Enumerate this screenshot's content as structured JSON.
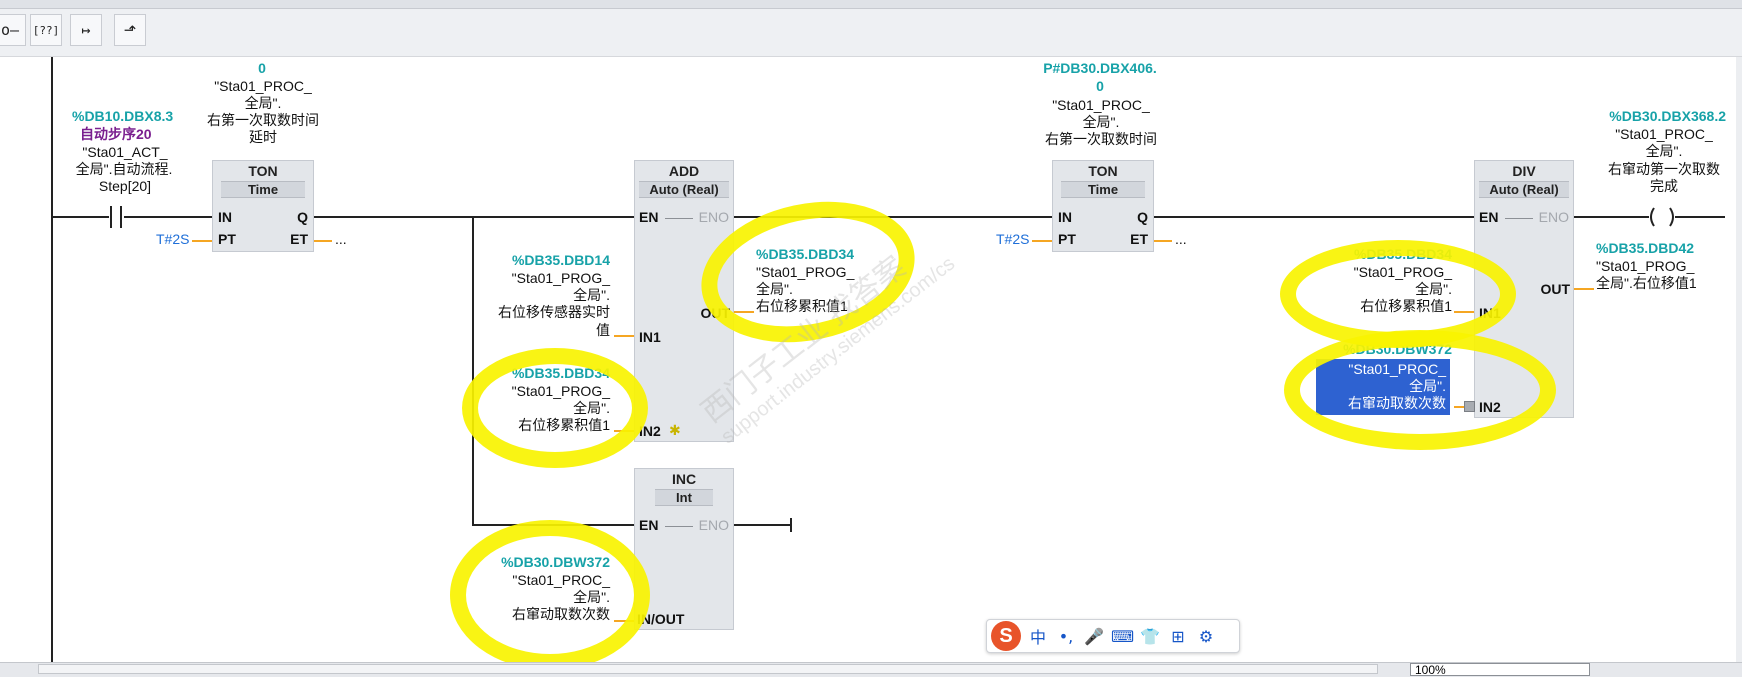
{
  "toolbar": {
    "buttons": [
      {
        "name": "open-branch-icon",
        "glyph": "o—"
      },
      {
        "name": "empty-box-icon",
        "glyph": "[??]"
      },
      {
        "name": "branch-open-icon",
        "glyph": "↦"
      },
      {
        "name": "branch-close-icon",
        "glyph": "⬏"
      }
    ]
  },
  "network": {
    "contact1": {
      "address": "%DB10.DBX8.3",
      "comment": "自动步序20",
      "l1": "\"Sta01_ACT_",
      "l2": "全局\".自动流程.",
      "l3": "Step[20]"
    },
    "ton1": {
      "top_value": "0",
      "l1": "\"Sta01_PROC_",
      "l2": "全局\".",
      "l3": "右第一次取数时间",
      "l4": "延时",
      "title": "TON",
      "type": "Time",
      "pt": "T#2S",
      "et": "...",
      "pins": {
        "in": "IN",
        "q": "Q",
        "pt": "PT",
        "et": "ET"
      }
    },
    "add": {
      "title": "ADD",
      "type": "Auto (Real)",
      "en": "EN",
      "eno": "ENO",
      "out": "OUT",
      "in1": "IN1",
      "in2": "IN2",
      "in1_addr": "%DB35.DBD14",
      "in1_l1": "\"Sta01_PROG_",
      "in1_l2": "全局\".",
      "in1_l3": "右位移传感器实时",
      "in1_l4": "值",
      "in2_addr": "%DB35.DBD34",
      "in2_l1": "\"Sta01_PROG_",
      "in2_l2": "全局\".",
      "in2_l3": "右位移累积值1",
      "out_addr": "%DB35.DBD34",
      "out_l1": "\"Sta01_PROG_",
      "out_l2": "全局\".",
      "out_l3": "右位移累积值1"
    },
    "inc": {
      "title": "INC",
      "type": "Int",
      "en": "EN",
      "eno": "ENO",
      "inout": "IN/OUT",
      "addr": "%DB30.DBW372",
      "l1": "\"Sta01_PROC_",
      "l2": "全局\".",
      "l3": "右窜动取数次数"
    },
    "ton2": {
      "top_addr": "P#DB30.DBX406.",
      "top_value": "0",
      "l1": "\"Sta01_PROC_",
      "l2": "全局\".",
      "l3": "右第一次取数时间",
      "title": "TON",
      "type": "Time",
      "pt": "T#2S",
      "et": "...",
      "pins": {
        "in": "IN",
        "q": "Q",
        "pt": "PT",
        "et": "ET"
      }
    },
    "div": {
      "title": "DIV",
      "type": "Auto (Real)",
      "en": "EN",
      "eno": "ENO",
      "out": "OUT",
      "in1": "IN1",
      "in2": "IN2",
      "in1_addr": "%DB35.DBD34",
      "in1_l1": "\"Sta01_PROG_",
      "in1_l2": "全局\".",
      "in1_l3": "右位移累积值1",
      "in2_addr": "%DB30.DBW372",
      "in2_l1": "\"Sta01_PROC_",
      "in2_l2": "全局\".",
      "in2_l3": "右窜动取数次数",
      "out_addr": "%DB35.DBD42",
      "out_l1": "\"Sta01_PROG_",
      "out_l2": "全局\".右位移值1"
    },
    "coil": {
      "address": "%DB30.DBX368.2",
      "l1": "\"Sta01_PROC_",
      "l2": "全局\".",
      "l3": "右窜动第一次取数",
      "l4": "完成"
    }
  },
  "watermark": {
    "line1": "西门子工业  找答案",
    "line2": "support.industry.siemens.com/cs"
  },
  "ime": {
    "logo": "S",
    "items": [
      "中",
      "•,",
      "🎤",
      "⌨",
      "👕",
      "⊞",
      "⚙"
    ]
  },
  "statusbar": {
    "zoom": "100%"
  }
}
